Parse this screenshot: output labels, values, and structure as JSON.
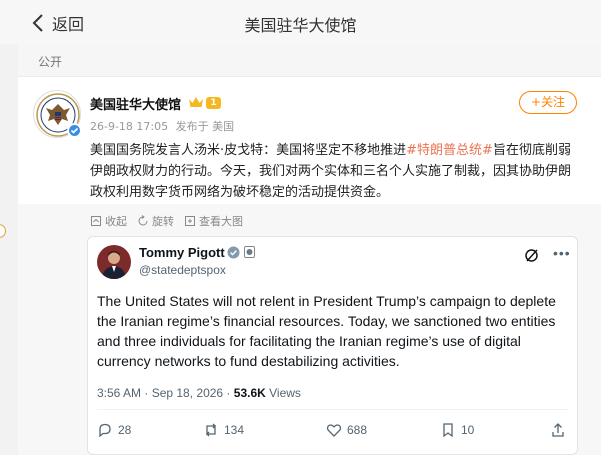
{
  "nav": {
    "back_label": "返回",
    "title": "美国驻华大使馆"
  },
  "visibility": "公开",
  "post": {
    "author": "美国驻华大使馆",
    "level_badge": "1",
    "timestamp": "26-9-18 17:05",
    "source": "发布于 美国",
    "follow_label": "+关注",
    "text_part1": "美国国务院发言人汤米·皮戈特：美国将坚定不移地推进",
    "hashtag": "#特朗普总统#",
    "text_part2": "旨在彻底削弱伊朗政权财力的行动。今天，我们对两个实体和三名个人实施了制裁，因其协助伊朗政权利用数字货币网络为破坏稳定的活动提供资金。"
  },
  "actions": {
    "collect": "收起",
    "rotate": "旋转",
    "view_large": "查看大图"
  },
  "tweet": {
    "name": "Tommy Pigott",
    "handle": "@statedeptspox",
    "text": "The United States will not relent in President Trump’s campaign to deplete the Iranian regime’s financial resources. Today, we sanctioned two entities and three individuals for facilitating the Iranian regime’s use of digital currency networks to fund destabilizing activities.",
    "time": "3:56 AM · Sep 18, 2026 · ",
    "views_count": "53.6K",
    "views_label": " Views",
    "replies": "28",
    "reposts": "134",
    "likes": "688",
    "bookmarks": "10"
  },
  "colors": {
    "accent": "#ff8200",
    "hashtag": "#eb7350",
    "verified": "#3a8ee6",
    "x_verified": "#829aab"
  }
}
